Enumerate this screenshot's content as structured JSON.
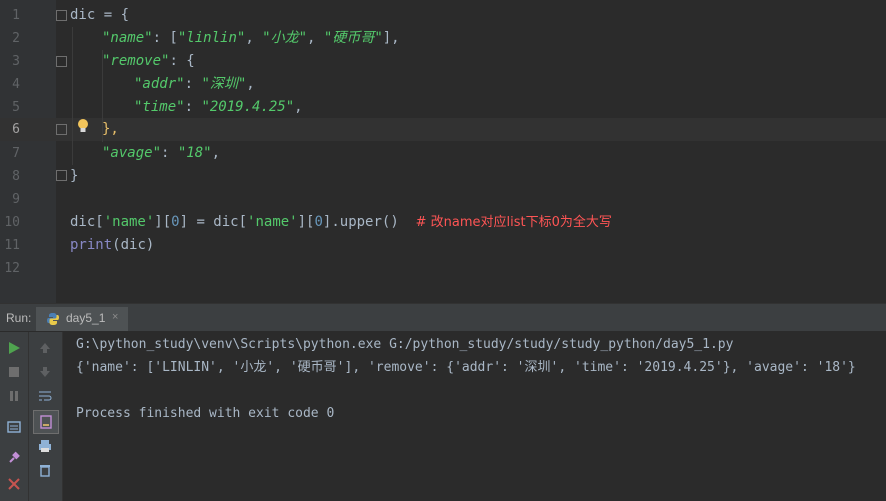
{
  "editor": {
    "line_numbers": [
      "1",
      "2",
      "3",
      "4",
      "5",
      "6",
      "7",
      "8",
      "9",
      "10",
      "11",
      "12"
    ],
    "lines": {
      "l1": {
        "a": "dic",
        "b": " = {"
      },
      "l2": {
        "key": "\"name\"",
        "colon": ": [",
        "v1": "\"linlin\"",
        "sep1": ", ",
        "v2": "\"小龙\"",
        "sep2": ", ",
        "v3": "\"硬币哥\"",
        "end": "],"
      },
      "l3": {
        "key": "\"remove\"",
        "end": ": {"
      },
      "l4": {
        "key": "\"addr\"",
        "colon": ": ",
        "val": "\"深圳\"",
        "end": ","
      },
      "l5": {
        "key": "\"time\"",
        "colon": ": ",
        "val": "\"2019.4.25\"",
        "end": ","
      },
      "l6": {
        "text": "},"
      },
      "l7": {
        "key": "\"avage\"",
        "colon": ": ",
        "val": "\"18\"",
        "end": ","
      },
      "l8": {
        "text": "}"
      },
      "l10": {
        "a": "dic[",
        "k1": "'name'",
        "b": "][",
        "n1": "0",
        "c": "] = dic[",
        "k2": "'name'",
        "d": "][",
        "n2": "0",
        "e": "].upper()",
        "comment": "# 改name对应list下标0为全大写"
      },
      "l11": {
        "fn": "print",
        "arg": "(dic)"
      }
    }
  },
  "run_panel": {
    "label": "Run:",
    "tab_label": "day5_1",
    "tab_close": "×",
    "console": {
      "command": "G:\\python_study\\venv\\Scripts\\python.exe G:/python_study/study/study_python/day5_1.py",
      "output": "{'name': ['LINLIN', '小龙', '硬币哥'], 'remove': {'addr': '深圳', 'time': '2019.4.25'}, 'avage': '18'}",
      "exit": "Process finished with exit code 0"
    }
  },
  "colors": {
    "background": "#2b2b2b",
    "string_key": "#54c96b",
    "comment": "#ff5555",
    "run_green": "#4fa34f",
    "stop_red": "#c75450"
  }
}
